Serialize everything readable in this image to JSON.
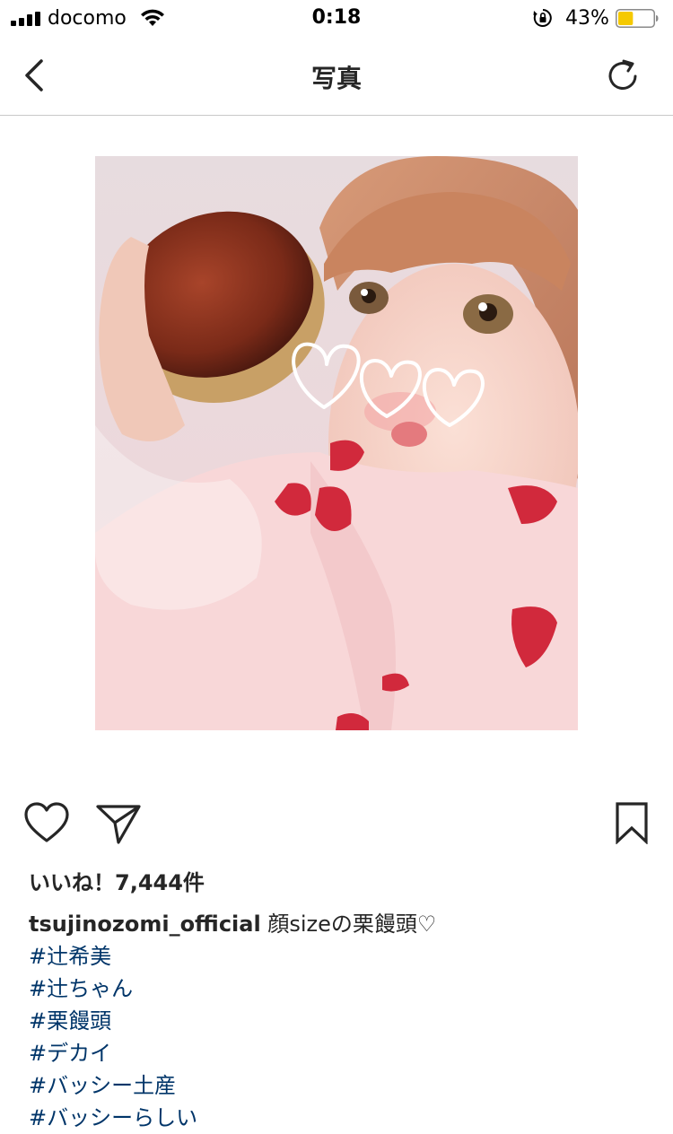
{
  "status_bar": {
    "carrier": "docomo",
    "time": "0:18",
    "battery_percent": "43%",
    "battery_level": 0.43,
    "battery_color": "#f5c900"
  },
  "nav": {
    "title": "写真",
    "back_icon": "chevron-left-icon",
    "refresh_icon": "refresh-icon"
  },
  "post": {
    "likes": "いいね！7,444件",
    "username": "tsujinozomi_official",
    "caption_text": " 顔sizeの栗饅頭♡",
    "hashtags": [
      "#辻希美",
      "#辻ちゃん",
      "#栗饅頭",
      "#デカイ",
      "#バッシー土産",
      "#バッシーらしい"
    ],
    "hashtag_color": "#003569"
  }
}
